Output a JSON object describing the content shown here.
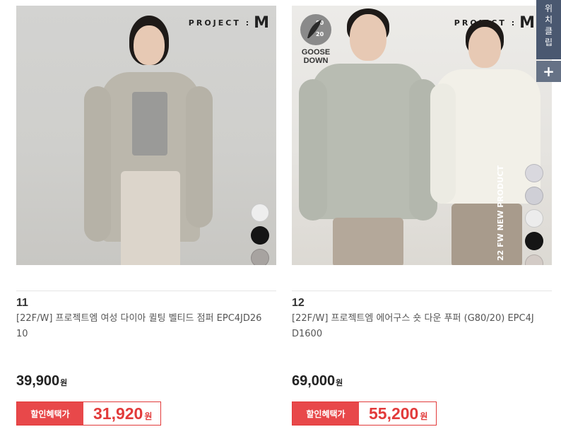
{
  "products": [
    {
      "brand_logo_text": "PROJECT :",
      "brand_logo_mark": "M",
      "number": "11",
      "name": "[22F/W] 프로젝트엠 여성 다이아 퀼팅 벨티드 점퍼 EPC4JD2610",
      "price": "39,900",
      "price_unit": "원",
      "discount_label": "할인혜택가",
      "discount_price": "31,920",
      "discount_unit": "원",
      "swatch_colors": [
        "#eeeeee",
        "#151515",
        "#a7a3a0"
      ]
    },
    {
      "brand_logo_text": "PROJECT :",
      "brand_logo_mark": "M",
      "badge_ratio_top": "80",
      "badge_ratio_bottom": "20",
      "badge_label_line1": "GOOSE",
      "badge_label_line2": "DOWN",
      "vertical_text": "22 FW NEW PRODUCT",
      "number": "12",
      "name": "[22F/W] 프로젝트엠 에어구스 숏 다운 푸퍼 (G80/20) EPC4JD1600",
      "price": "69,000",
      "price_unit": "원",
      "discount_label": "할인혜택가",
      "discount_price": "55,200",
      "discount_unit": "원",
      "swatch_colors": [
        "#d9d8de",
        "#cfcfd6",
        "#ececec",
        "#151515",
        "#d3cbc6"
      ]
    }
  ],
  "quick_menu": {
    "label": [
      "위",
      "치",
      "클",
      "립"
    ],
    "add_label": "+"
  },
  "colors": {
    "accent_red": "#e8484a",
    "quick_menu_bg": "#4a5870"
  }
}
